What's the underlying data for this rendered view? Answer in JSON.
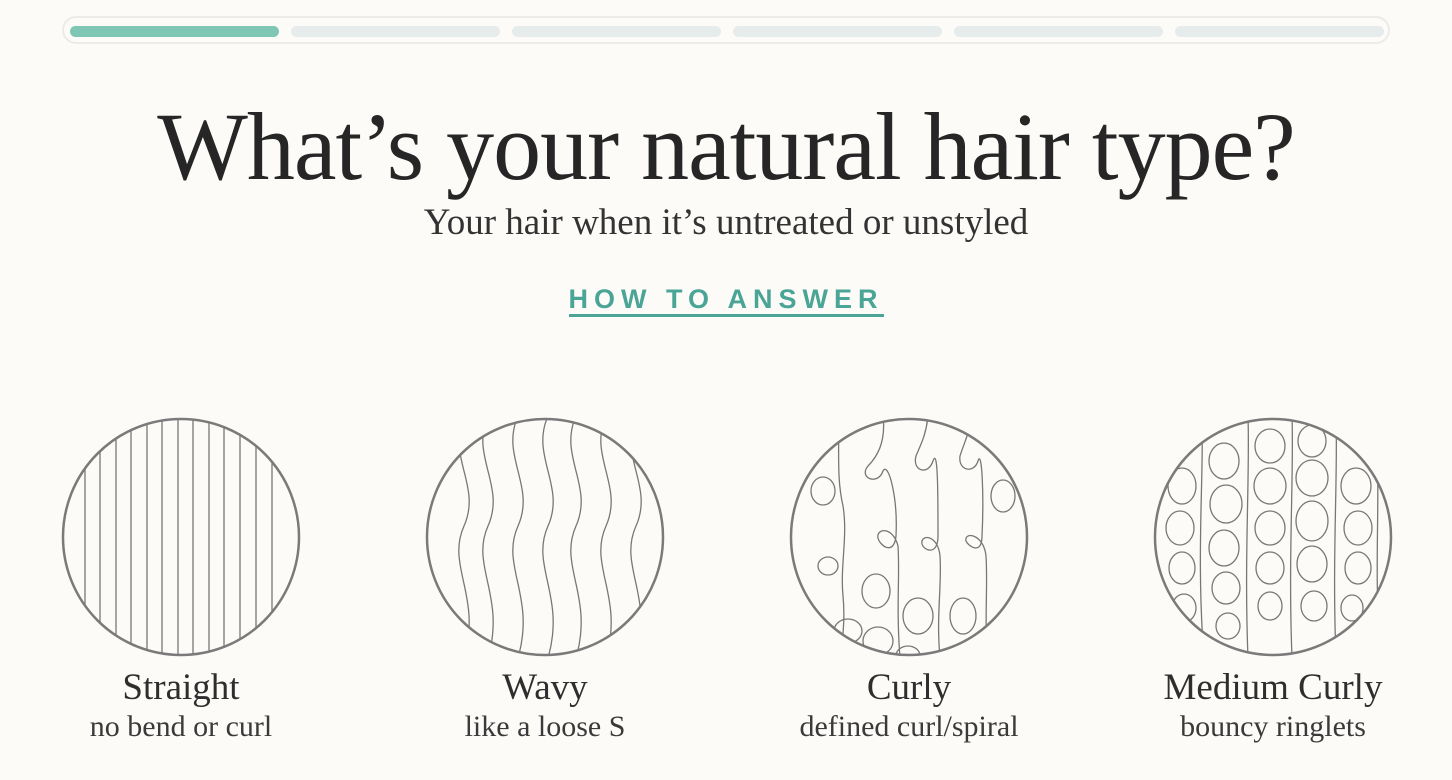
{
  "progress": {
    "total_steps": 6,
    "completed_steps": 1
  },
  "question": {
    "title": "What’s your natural hair type?",
    "subtitle": "Your hair when it’s untreated or unstyled",
    "help_link": "HOW TO ANSWER"
  },
  "options": [
    {
      "label": "Straight",
      "description": "no bend or curl",
      "icon": "straight-hair-icon"
    },
    {
      "label": "Wavy",
      "description": "like a loose S",
      "icon": "wavy-hair-icon"
    },
    {
      "label": "Curly",
      "description": "defined curl/spiral",
      "icon": "curly-hair-icon"
    },
    {
      "label": "Medium Curly",
      "description": "bouncy ringlets",
      "icon": "medium-curly-hair-icon"
    }
  ],
  "colors": {
    "accent": "#4aa596",
    "progress_done": "#7fc6b4",
    "progress_todo": "#e6ebec",
    "background": "#fdfbf8",
    "icon_stroke": "#7a7a7a"
  }
}
